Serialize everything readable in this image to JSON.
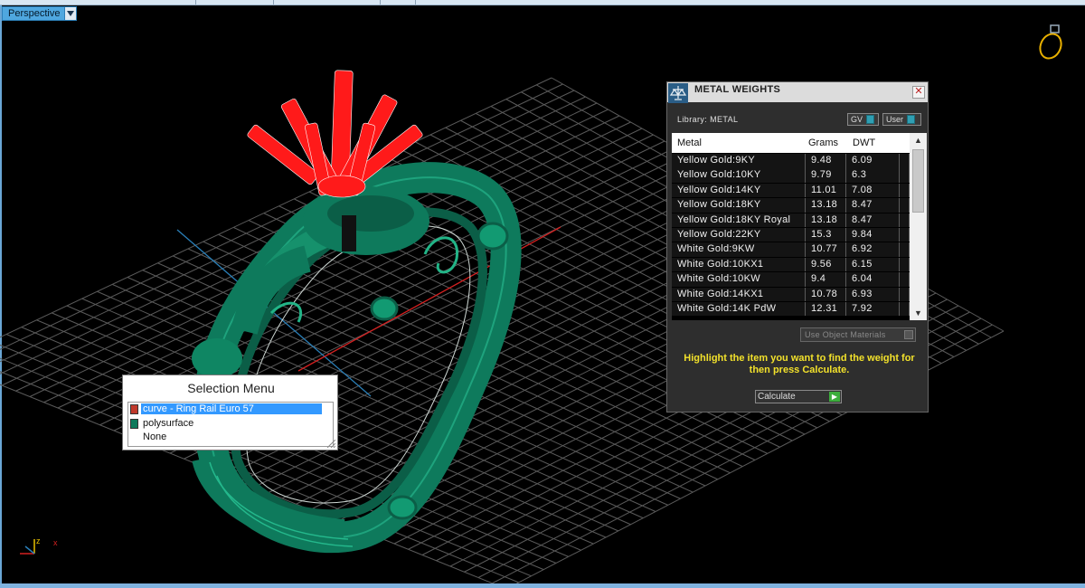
{
  "viewport": {
    "name": "Perspective"
  },
  "colors": {
    "ring_green": "#0e7a5c",
    "head_red": "#ff1a1a",
    "grid": "#5a5a5a",
    "accent_blue": "#4fa7df",
    "hint_yellow": "#f2e12b"
  },
  "metal_weights": {
    "title": "METAL WEIGHTS",
    "library_label": "Library: METAL",
    "gv_label": "GV",
    "user_label": "User",
    "columns": [
      "Metal",
      "Grams",
      "DWT"
    ],
    "rows": [
      [
        "Yellow Gold:9KY",
        "9.48",
        "6.09"
      ],
      [
        "Yellow Gold:10KY",
        "9.79",
        "6.3"
      ],
      [
        "Yellow Gold:14KY",
        "11.01",
        "7.08"
      ],
      [
        "Yellow Gold:18KY",
        "13.18",
        "8.47"
      ],
      [
        "Yellow Gold:18KY Royal",
        "13.18",
        "8.47"
      ],
      [
        "Yellow Gold:22KY",
        "15.3",
        "9.84"
      ],
      [
        "White Gold:9KW",
        "10.77",
        "6.92"
      ],
      [
        "White Gold:10KX1",
        "9.56",
        "6.15"
      ],
      [
        "White Gold:10KW",
        "9.4",
        "6.04"
      ],
      [
        "White Gold:14KX1",
        "10.78",
        "6.93"
      ],
      [
        "White Gold:14K PdW",
        "12.31",
        "7.92"
      ]
    ],
    "use_object_materials": "Use Object Materials",
    "hint": "Highlight the item you want to find the weight for then press Calculate.",
    "calculate_label": "Calculate"
  },
  "selection_menu": {
    "title": "Selection Menu",
    "items": [
      {
        "label": "curve - Ring Rail Euro 57",
        "swatch": "#c0392b",
        "selected": true
      },
      {
        "label": "polysurface",
        "swatch": "#0e7a5c",
        "selected": false
      },
      {
        "label": "None",
        "swatch": "",
        "selected": false
      }
    ]
  },
  "axis_icon": {
    "z": "z",
    "x": "x"
  }
}
